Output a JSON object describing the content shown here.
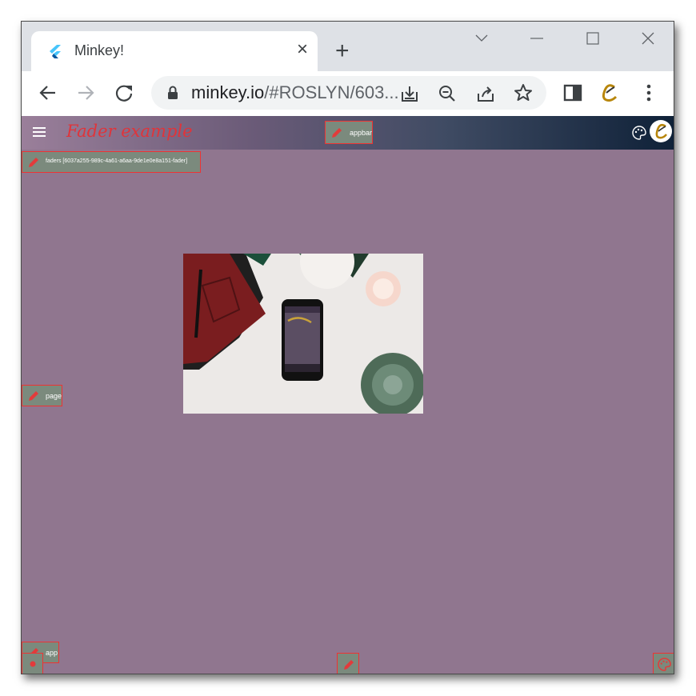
{
  "browser": {
    "tab_title": "Minkey!",
    "tab_close": "×",
    "new_tab": "+",
    "url_host": "minkey.io",
    "url_rest": "/#ROSLYN/603..."
  },
  "app": {
    "title": "Fader example"
  },
  "debug": {
    "appbar_label": "appbar",
    "faders_label": "faders [6037a255-989c-4a61-a6aa-9de1e0e8a151-fader]",
    "page_label": "page",
    "app_label": "app"
  },
  "colors": {
    "page_bg": "#90768f",
    "title_red": "#e0343a",
    "chip_bg": "#7b8a7d",
    "chip_border": "#e33333"
  }
}
